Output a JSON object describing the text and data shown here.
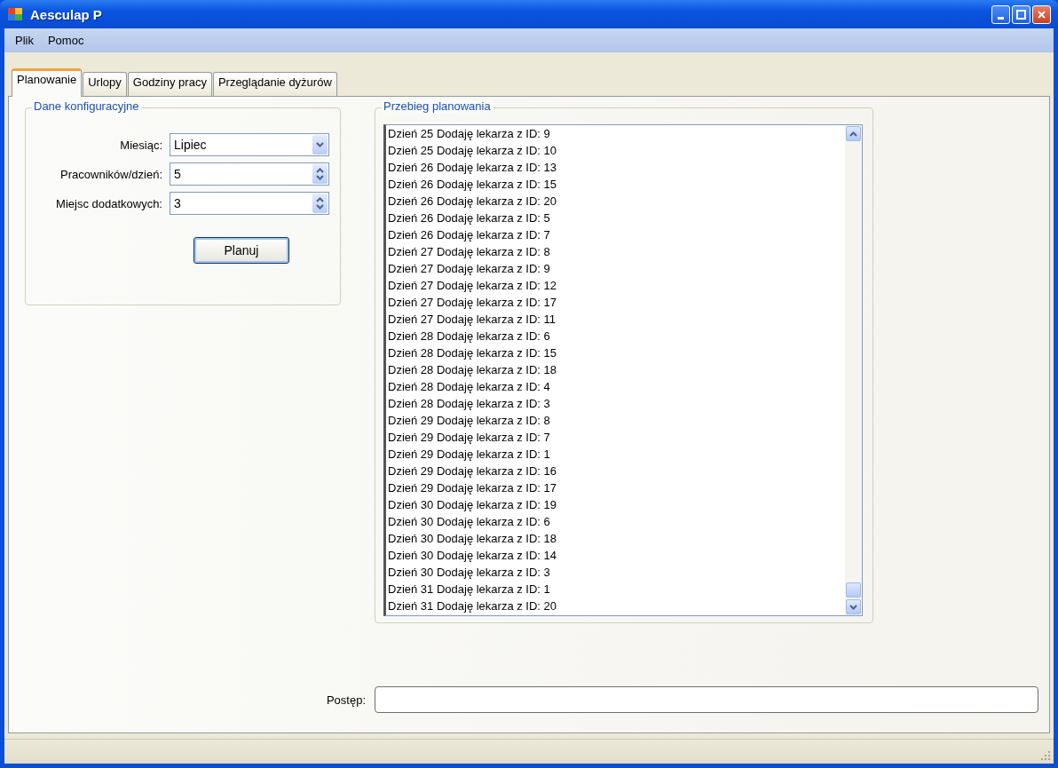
{
  "window": {
    "title": "Aesculap P"
  },
  "menu": [
    {
      "label": "Plik"
    },
    {
      "label": "Pomoc"
    }
  ],
  "tabs": [
    {
      "label": "Planowanie",
      "selected": true
    },
    {
      "label": "Urlopy",
      "selected": false
    },
    {
      "label": "Godziny pracy",
      "selected": false
    },
    {
      "label": "Przeglądanie dyżurów",
      "selected": false
    }
  ],
  "config": {
    "title": "Dane konfiguracyjne",
    "fields": [
      {
        "kind": "combo",
        "label": "Miesiąc:",
        "value": "Lipiec"
      },
      {
        "kind": "spin",
        "label": "Pracowników/dzień:",
        "value": "5"
      },
      {
        "kind": "spin",
        "label": "Miejsc dodatkowych:",
        "value": "3"
      }
    ],
    "button": "Planuj"
  },
  "log": {
    "title": "Przebieg planowania",
    "lines": [
      "Dzień 25 Dodaję lekarza z ID: 9",
      "Dzień 25 Dodaję lekarza z ID: 10",
      "Dzień 26 Dodaję lekarza z ID: 13",
      "Dzień 26 Dodaję lekarza z ID: 15",
      "Dzień 26 Dodaję lekarza z ID: 20",
      "Dzień 26 Dodaję lekarza z ID: 5",
      "Dzień 26 Dodaję lekarza z ID: 7",
      "Dzień 27 Dodaję lekarza z ID: 8",
      "Dzień 27 Dodaję lekarza z ID: 9",
      "Dzień 27 Dodaję lekarza z ID: 12",
      "Dzień 27 Dodaję lekarza z ID: 17",
      "Dzień 27 Dodaję lekarza z ID: 11",
      "Dzień 28 Dodaję lekarza z ID: 6",
      "Dzień 28 Dodaję lekarza z ID: 15",
      "Dzień 28 Dodaję lekarza z ID: 18",
      "Dzień 28 Dodaję lekarza z ID: 4",
      "Dzień 28 Dodaję lekarza z ID: 3",
      "Dzień 29 Dodaję lekarza z ID: 8",
      "Dzień 29 Dodaję lekarza z ID: 7",
      "Dzień 29 Dodaję lekarza z ID: 1",
      "Dzień 29 Dodaję lekarza z ID: 16",
      "Dzień 29 Dodaję lekarza z ID: 17",
      "Dzień 30 Dodaję lekarza z ID: 19",
      "Dzień 30 Dodaję lekarza z ID: 6",
      "Dzień 30 Dodaję lekarza z ID: 18",
      "Dzień 30 Dodaję lekarza z ID: 14",
      "Dzień 30 Dodaję lekarza z ID: 3",
      "Dzień 31 Dodaję lekarza z ID: 1",
      "Dzień 31 Dodaję lekarza z ID: 20"
    ]
  },
  "progress": {
    "label": "Postęp:",
    "level": 0
  }
}
